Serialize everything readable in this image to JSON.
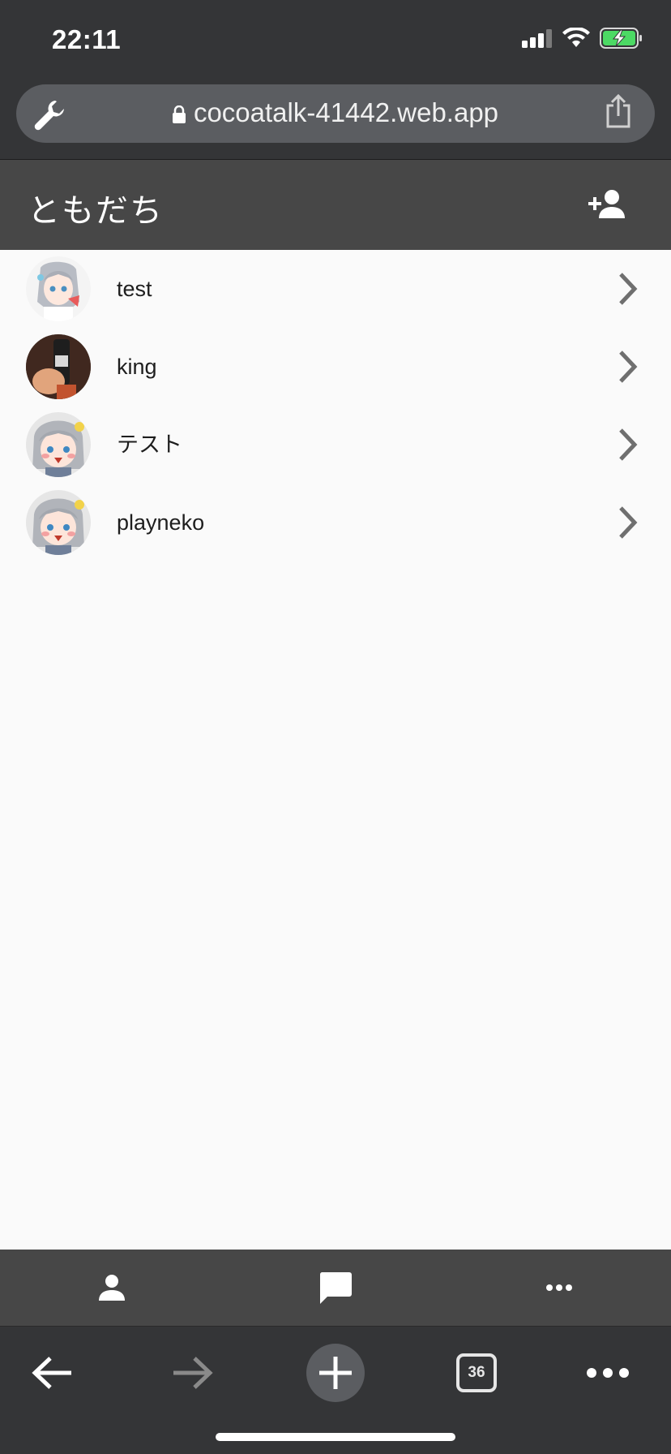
{
  "status": {
    "time": "22:11"
  },
  "browser": {
    "url": "cocoatalk-41442.web.app",
    "tab_count": "36"
  },
  "app": {
    "title": "ともだち",
    "friends": [
      {
        "name": "test",
        "avatar": "anime-girl-avatar"
      },
      {
        "name": "king",
        "avatar": "drink-can-photo-avatar"
      },
      {
        "name": "テスト",
        "avatar": "anime-girl-avatar"
      },
      {
        "name": "playneko",
        "avatar": "anime-girl-avatar"
      }
    ],
    "nav": [
      {
        "icon": "person-icon"
      },
      {
        "icon": "chat-bubble-icon"
      },
      {
        "icon": "more-horizontal-icon"
      }
    ]
  },
  "colors": {
    "statusbar": "#343537",
    "appbar": "#474747",
    "list_bg": "#fafafa",
    "battery_green": "#4cd964"
  }
}
